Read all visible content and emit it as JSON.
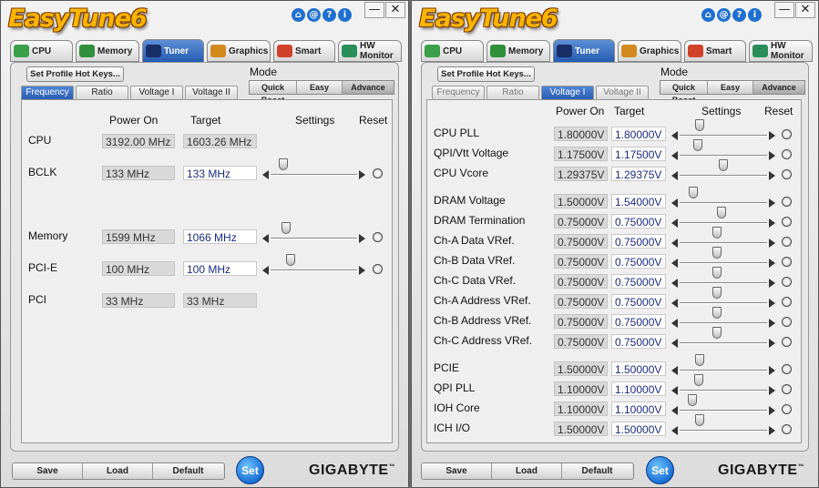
{
  "app": {
    "logo": "EasyTune6",
    "brand": "GIGABYTE",
    "brand_tm": "™"
  },
  "header_icons": [
    "home-icon",
    "at-icon",
    "help-icon",
    "info-icon"
  ],
  "header_glyphs": [
    "⌂",
    "@",
    "?",
    "i"
  ],
  "window_buttons": {
    "minimize": "—",
    "close": "✕"
  },
  "main_tabs": [
    {
      "label": "CPU",
      "icon": "cpu-chip-icon",
      "color": "#3aa04a"
    },
    {
      "label": "Memory",
      "icon": "memory-stick-icon",
      "color": "#2f8f3a"
    },
    {
      "label": "Tuner",
      "icon": "gauge-icon",
      "color": "#1a2e66"
    },
    {
      "label": "Graphics",
      "icon": "graphics-card-icon",
      "color": "#d28a1e"
    },
    {
      "label": "Smart",
      "icon": "cube-icon",
      "color": "#d0432a"
    },
    {
      "label": "HW Monitor",
      "icon": "monitor-icon",
      "color": "#2a8e5a"
    }
  ],
  "hotkey_label": "Set Profile Hot Keys...",
  "mode": {
    "label": "Mode",
    "options": [
      "Quick Boost",
      "Easy",
      "Advance"
    ],
    "selected": "Advance"
  },
  "sub_tabs": [
    "Frequency",
    "Ratio",
    "Voltage I",
    "Voltage II"
  ],
  "left": {
    "active_tab": "Frequency",
    "columns": {
      "power_on": "Power On",
      "target": "Target",
      "settings": "Settings",
      "reset": "Reset"
    },
    "rows": [
      {
        "label": "CPU",
        "power_on": "3192.00 MHz",
        "target": "1603.26 MHz",
        "editable": false,
        "has_slider": false,
        "slider_pos": null
      },
      {
        "label": "BCLK",
        "power_on": "133 MHz",
        "target": "133 MHz",
        "editable": true,
        "has_slider": true,
        "slider_pos": 0.11
      },
      {
        "label": "Memory",
        "power_on": "1599 MHz",
        "target": "1066 MHz",
        "editable": true,
        "has_slider": true,
        "slider_pos": 0.14
      },
      {
        "label": "PCI-E",
        "power_on": "100 MHz",
        "target": "100 MHz",
        "editable": true,
        "has_slider": true,
        "slider_pos": 0.2
      },
      {
        "label": "PCI",
        "power_on": "33 MHz",
        "target": "33 MHz",
        "editable": false,
        "has_slider": false,
        "slider_pos": null
      }
    ]
  },
  "right": {
    "active_tab": "Voltage I",
    "columns": {
      "power_on": "Power On",
      "target": "Target",
      "settings": "Settings",
      "reset": "Reset"
    },
    "rows": [
      {
        "label": "CPU PLL",
        "power_on": "1.80000V",
        "target": "1.80000V",
        "slider_pos": 0.2
      },
      {
        "label": "QPI/Vtt Voltage",
        "power_on": "1.17500V",
        "target": "1.17500V",
        "slider_pos": 0.17
      },
      {
        "label": "CPU Vcore",
        "power_on": "1.29375V",
        "target": "1.29375V",
        "slider_pos": 0.5
      },
      {
        "label": "DRAM Voltage",
        "power_on": "1.50000V",
        "target": "1.54000V",
        "slider_pos": 0.12
      },
      {
        "label": "DRAM Termination",
        "power_on": "0.75000V",
        "target": "0.75000V",
        "slider_pos": 0.48
      },
      {
        "label": "Ch-A Data VRef.",
        "power_on": "0.75000V",
        "target": "0.75000V",
        "slider_pos": 0.42
      },
      {
        "label": "Ch-B Data VRef.",
        "power_on": "0.75000V",
        "target": "0.75000V",
        "slider_pos": 0.42
      },
      {
        "label": "Ch-C Data VRef.",
        "power_on": "0.75000V",
        "target": "0.75000V",
        "slider_pos": 0.42
      },
      {
        "label": "Ch-A Address VRef.",
        "power_on": "0.75000V",
        "target": "0.75000V",
        "slider_pos": 0.42
      },
      {
        "label": "Ch-B Address VRef.",
        "power_on": "0.75000V",
        "target": "0.75000V",
        "slider_pos": 0.42
      },
      {
        "label": "Ch-C Address VRef.",
        "power_on": "0.75000V",
        "target": "0.75000V",
        "slider_pos": 0.42
      },
      {
        "label": "PCIE",
        "power_on": "1.50000V",
        "target": "1.50000V",
        "slider_pos": 0.2
      },
      {
        "label": "QPI PLL",
        "power_on": "1.10000V",
        "target": "1.10000V",
        "slider_pos": 0.19
      },
      {
        "label": "IOH Core",
        "power_on": "1.10000V",
        "target": "1.10000V",
        "slider_pos": 0.1
      },
      {
        "label": "ICH I/O",
        "power_on": "1.50000V",
        "target": "1.50000V",
        "slider_pos": 0.2
      }
    ]
  },
  "bottom": {
    "save": "Save",
    "load": "Load",
    "default": "Default",
    "set": "Set"
  }
}
